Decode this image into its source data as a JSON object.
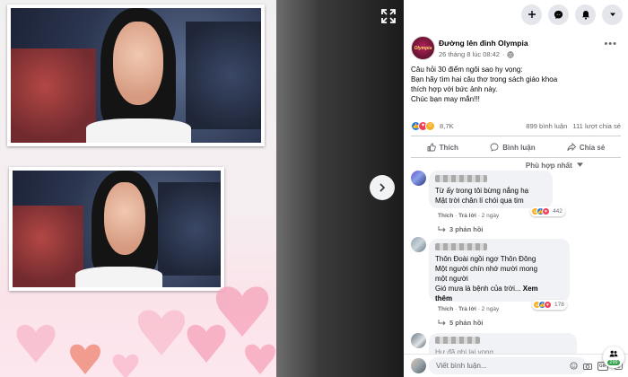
{
  "topbar": {
    "icons": [
      "plus-icon",
      "messenger-icon",
      "bell-icon",
      "chevron-down-icon"
    ]
  },
  "post": {
    "page_name": "Đường lên đỉnh Olympia",
    "logo_text": "Olympia",
    "time": "26 tháng 8 lúc 08:42",
    "privacy_icon": "globe-icon",
    "text_lines": [
      "Câu hỏi 30 điểm ngôi sao hy vọng:",
      "Bạn hãy tìm hai câu thơ trong sách giáo khoa",
      "thích hợp với bức ảnh này.",
      "Chúc bạn may mắn!!!"
    ],
    "reaction_count": "8,7K",
    "comment_count": "899 bình luận",
    "share_count": "111 lượt chia sẻ",
    "actions": {
      "like": "Thích",
      "comment": "Bình luận",
      "share": "Chia sẻ"
    },
    "sort_label": "Phù hợp nhất"
  },
  "comments": [
    {
      "lines": [
        "Từ ấy trong tôi bừng nắng hạ",
        "Mặt trời chân lí chói qua tim"
      ],
      "like_label": "Thích",
      "reply_label": "Trả lời",
      "age": "2 ngày",
      "reactions": "442",
      "replies": "3 phản hồi"
    },
    {
      "lines": [
        "Thôn Đoài ngồi ngơ Thôn Đông",
        "Một người chín nhớ mười mong",
        "một người",
        "Gió mưa là bệnh của trời..."
      ],
      "see_more": "Xem",
      "see_more_2": "thêm",
      "like_label": "Thích",
      "reply_label": "Trả lời",
      "age": "2 ngày",
      "reactions": "178",
      "replies": "5 phản hồi"
    }
  ],
  "partial_comment_text": "Hư đã ghi lại vọng",
  "composer": {
    "placeholder": "Viết bình luận..."
  },
  "online_count": "299",
  "viewer": {
    "expand_icon": "expand-icon",
    "next_icon": "chevron-right-icon"
  }
}
